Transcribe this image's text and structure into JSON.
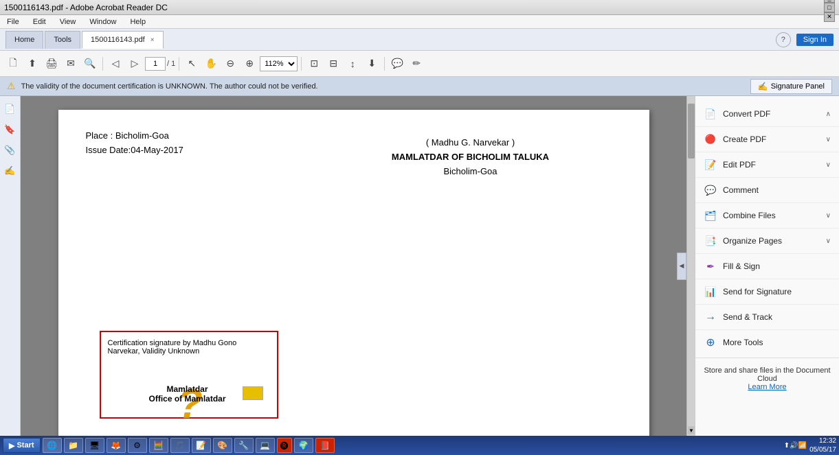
{
  "titlebar": {
    "text": "1500116143.pdf - Adobe Acrobat Reader DC",
    "controls": [
      "_",
      "□",
      "✕"
    ]
  },
  "menubar": {
    "items": [
      "File",
      "Edit",
      "View",
      "Window",
      "Help"
    ]
  },
  "navbar": {
    "home_label": "Home",
    "tools_label": "Tools",
    "tab_label": "1500116143.pdf",
    "tab_close": "×",
    "help_icon": "?",
    "signin_label": "Sign In"
  },
  "toolbar": {
    "zoom_value": "112%",
    "page_current": "1",
    "page_total": "1"
  },
  "notif": {
    "text": "The validity of the document certification is UNKNOWN. The author could not be verified.",
    "sig_panel_label": "Signature Panel"
  },
  "pdf": {
    "place": "Place : Bicholim-Goa",
    "issue_date": "Issue Date:04-May-2017",
    "authority_name": "( Madhu G. Narvekar )",
    "authority_title": "MAMLATDAR OF BICHOLIM TALUKA",
    "authority_location": "Bicholim-Goa",
    "sig_text1": "Certification signature by Madhu Gono",
    "sig_text2": "Narvekar, Validity Unknown",
    "sig_text3": "Mamlatdar",
    "sig_text4": "Office of Mamlatdar"
  },
  "right_panel": {
    "items": [
      {
        "id": "convert-pdf",
        "label": "Convert PDF",
        "icon": "📄",
        "icon_color": "icon-red",
        "has_arrow": true,
        "arrow_up": true
      },
      {
        "id": "create-pdf",
        "label": "Create PDF",
        "icon": "📋",
        "icon_color": "icon-red",
        "has_arrow": true,
        "arrow_down": true
      },
      {
        "id": "edit-pdf",
        "label": "Edit PDF",
        "icon": "✏️",
        "icon_color": "icon-blue",
        "has_arrow": true,
        "arrow_down": true
      },
      {
        "id": "comment",
        "label": "Comment",
        "icon": "💬",
        "icon_color": "icon-orange",
        "has_arrow": false
      },
      {
        "id": "combine-files",
        "label": "Combine Files",
        "icon": "📦",
        "icon_color": "icon-blue",
        "has_arrow": true,
        "arrow_down": true
      },
      {
        "id": "organize-pages",
        "label": "Organize Pages",
        "icon": "📑",
        "icon_color": "icon-teal",
        "has_arrow": true,
        "arrow_down": true
      },
      {
        "id": "fill-sign",
        "label": "Fill & Sign",
        "icon": "✒️",
        "icon_color": "icon-purple",
        "has_arrow": false
      },
      {
        "id": "send-signature",
        "label": "Send for Signature",
        "icon": "📊",
        "icon_color": "icon-blue",
        "has_arrow": false
      },
      {
        "id": "send-track",
        "label": "Send & Track",
        "icon": "→",
        "icon_color": "icon-blue",
        "has_arrow": false
      }
    ],
    "more_tools": {
      "label": "More Tools",
      "icon": "⊕"
    },
    "cloud_text": "Store and share files in the Document Cloud",
    "learn_more": "Learn More"
  },
  "statusbar": {
    "items": []
  },
  "taskbar": {
    "start_label": "Start",
    "apps": [
      "🌐",
      "📁",
      "🖥️",
      "🦊",
      "⚙️",
      "📊",
      "🎵",
      "📝",
      "🎨",
      "🔧",
      "💻"
    ],
    "time": "12:32",
    "date": "05/05/17"
  }
}
